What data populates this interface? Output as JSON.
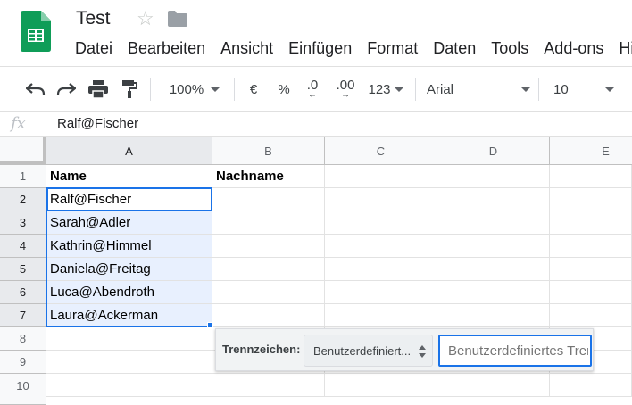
{
  "document": {
    "title": "Test"
  },
  "menu": [
    "Datei",
    "Bearbeiten",
    "Ansicht",
    "Einfügen",
    "Format",
    "Daten",
    "Tools",
    "Add-ons",
    "Hilfe"
  ],
  "toolbar": {
    "zoom": "100%",
    "currency": "€",
    "percent": "%",
    "decrease_decimals": ".0",
    "increase_decimals": ".00",
    "more_formats": "123",
    "font": "Arial",
    "font_size": "10"
  },
  "formula_bar": {
    "fx_label": "fx",
    "value": "Ralf@Fischer"
  },
  "columns": [
    "A",
    "B",
    "C",
    "D",
    "E"
  ],
  "rows": [
    "1",
    "2",
    "3",
    "4",
    "5",
    "6",
    "7",
    "8",
    "9",
    "10"
  ],
  "cells": {
    "A1": "Name",
    "B1": "Nachname",
    "A2": "Ralf@Fischer",
    "A3": "Sarah@Adler",
    "A4": "Kathrin@Himmel",
    "A5": "Daniela@Freitag",
    "A6": "Luca@Abendroth",
    "A7": "Laura@Ackerman"
  },
  "split_popup": {
    "label": "Trennzeichen:",
    "selected": "Benutzerdefiniert...",
    "input_placeholder": "Benutzerdefiniertes Trennzeichen"
  },
  "colors": {
    "accent": "#1a73e8",
    "sheets_green": "#0f9d58",
    "selection_fill": "#e8f0fe"
  }
}
